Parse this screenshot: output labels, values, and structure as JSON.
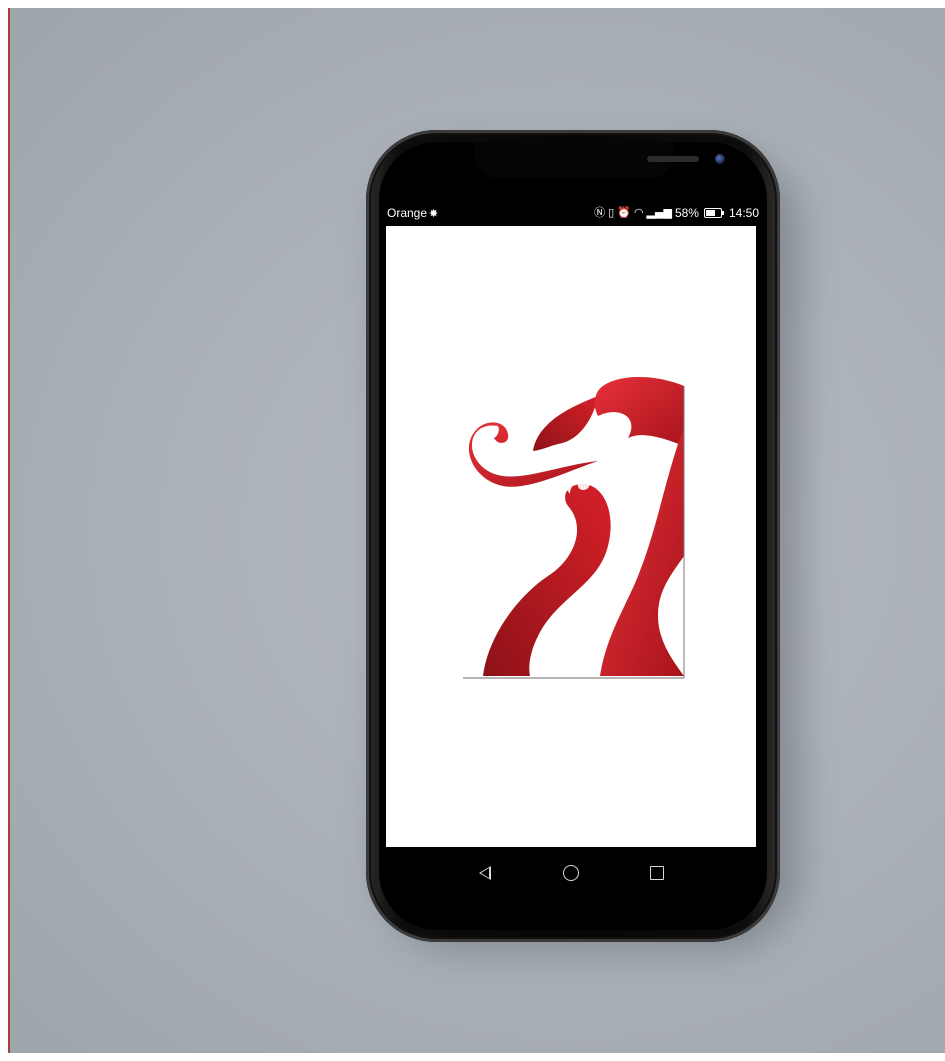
{
  "status_bar": {
    "carrier": "Orange",
    "battery_percent": "58%",
    "time": "14:50"
  },
  "icons": {
    "carrier_icon": "carrier-star-icon",
    "status_icons": [
      "nfc-icon",
      "vibrate-icon",
      "alarm-icon",
      "wifi-icon",
      "signal-icon",
      "battery-icon"
    ]
  },
  "nav_bar": {
    "buttons": [
      "back",
      "home",
      "recents"
    ]
  },
  "colors": {
    "logo_red": "#d4232b",
    "logo_dark_red": "#8e1218",
    "backdrop": "#aab1b7",
    "accent_line": "#a7423b"
  }
}
